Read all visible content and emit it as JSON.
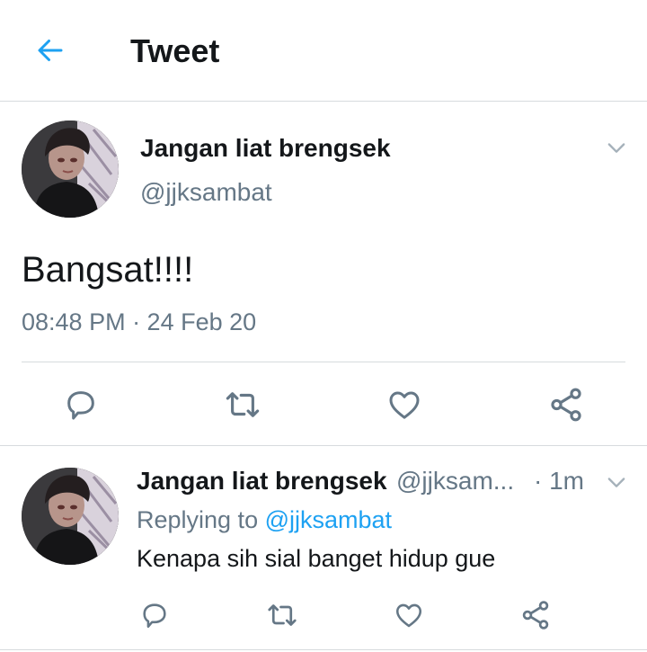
{
  "header": {
    "title": "Tweet",
    "back_icon": "arrow-left-icon"
  },
  "colors": {
    "accent": "#1da1f2",
    "icon": "#657786",
    "text": "#14171a",
    "border": "#d7dbde"
  },
  "main_tweet": {
    "display_name": "Jangan liat brengsek",
    "handle": "@jjksambat",
    "text": "Bangsat!!!!",
    "timestamp": "08:48 PM · 24 Feb 20"
  },
  "reply_tweet": {
    "display_name": "Jangan liat brengsek",
    "handle": "@jjksam...",
    "time": "· 1m",
    "replying_prefix": "Replying to",
    "replying_to": "@jjksambat",
    "text": "Kenapa sih sial banget hidup gue"
  },
  "actions": [
    "reply-icon",
    "retweet-icon",
    "like-icon",
    "share-icon"
  ]
}
